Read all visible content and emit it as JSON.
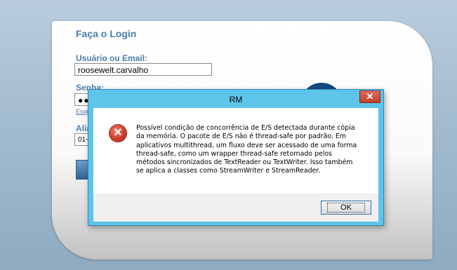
{
  "login": {
    "title": "Faça o Login",
    "user_label": "Usuário ou Email:",
    "user_value": "roosewelt.carvalho",
    "password_label": "Senha:",
    "password_value": "●●●",
    "forgot_link": "Esqu",
    "alias_label": "Alia",
    "alias_value": "01-"
  },
  "dialog": {
    "title": "RM",
    "close_label": "✕",
    "message": "Possível condição de concorrência de E/S detectada durante cópia da memória. O pacote de E/S não é thread-safe por padrão. Em aplicativos multithread, um fluxo deve ser acessado de uma forma thread-safe, como um wrapper thread-safe retornado pelos métodos sincronizados de TextReader ou TextWriter. Isso também se aplica a classes como StreamWriter e StreamReader.",
    "ok_label": "OK",
    "icon": "error-icon",
    "icon_glyph": "✕"
  },
  "colors": {
    "title_bar": "#5ec4ea",
    "close_button": "#c23e2a",
    "label_blue": "#4d7ea8"
  }
}
